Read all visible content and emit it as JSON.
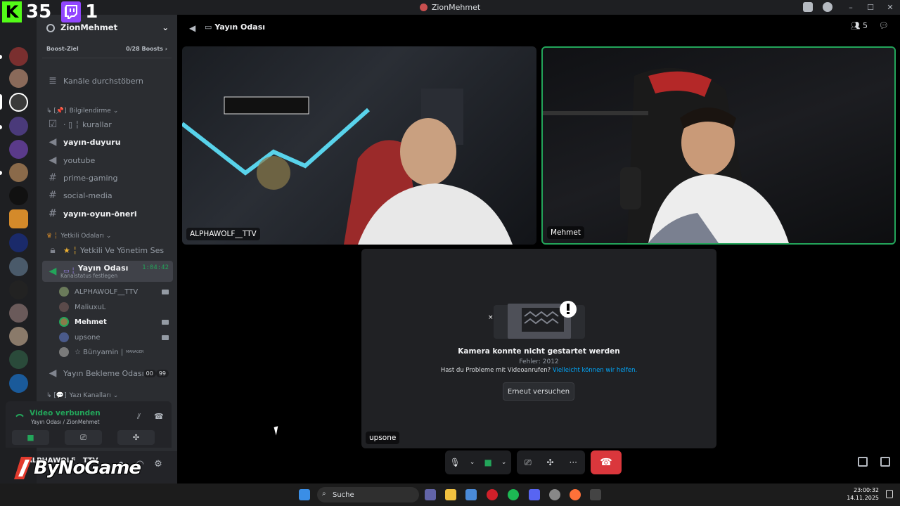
{
  "window": {
    "title": "ZionMehmet"
  },
  "overlay": {
    "kick_count": "35",
    "twitch_count": "1",
    "kick_glyph": "K"
  },
  "server": {
    "name": "ZionMehmet",
    "boost_label": "Boost-Ziel",
    "boost_count": "0/28 Boosts",
    "browse": "Kanäle durchstöbern"
  },
  "channels": {
    "cat_info": "Bilgilendirme",
    "kurallar": "kurallar",
    "yayin_duyuru": "yayın-duyuru",
    "youtube": "youtube",
    "prime_gaming": "prime-gaming",
    "social_media": "social-media",
    "yayin_oyun": "yayın-oyun-öneri",
    "cat_yetkili": "Yetkili Odaları",
    "yetkili_ses": "Yetkili Ve Yönetim Ses",
    "yayin_odasi": "Yayın Odası",
    "yayin_timer": "1:04:42",
    "kanalstatus": "Kanalstatus festlegen",
    "bekleme": "Yayın Bekleme Odası",
    "bekleme_count_a": "00",
    "bekleme_count_b": "99",
    "cat_yazi": "Yazı Kanalları"
  },
  "voice_users": [
    {
      "name": "ALPHAWOLF__TTV"
    },
    {
      "name": "MaliuxuL"
    },
    {
      "name": "Mehmet"
    },
    {
      "name": "upsone"
    },
    {
      "name": "☆ Bünyamin |",
      "badge": "MANAGER"
    }
  ],
  "voice_panel": {
    "status": "Video verbunden",
    "location": "Yayın Odası / ZionMehmet"
  },
  "user": {
    "name": "ALPHAWOLF__TTV"
  },
  "watermark": {
    "text": "ByNoGame"
  },
  "stage": {
    "channel": "Yayın Odası",
    "participants": "5"
  },
  "tiles": [
    {
      "name": "ALPHAWOLF__TTV"
    },
    {
      "name": "Mehmet"
    },
    {
      "name": "upsone"
    }
  ],
  "error": {
    "title": "Kamera konnte nicht gestartet werden",
    "code": "Fehler: 2012",
    "help_text": "Hast du Probleme mit Videoanrufen?",
    "help_link": "Vielleicht können wir helfen.",
    "retry": "Erneut versuchen"
  },
  "taskbar": {
    "search": "Suche",
    "time": "23:00:32",
    "date": "14.11.2025"
  },
  "colors": {
    "accent_green": "#23a55a",
    "hangup_red": "#da373c",
    "link_blue": "#00a8fc",
    "kick_green": "#53fc18",
    "twitch_purple": "#9146ff"
  }
}
